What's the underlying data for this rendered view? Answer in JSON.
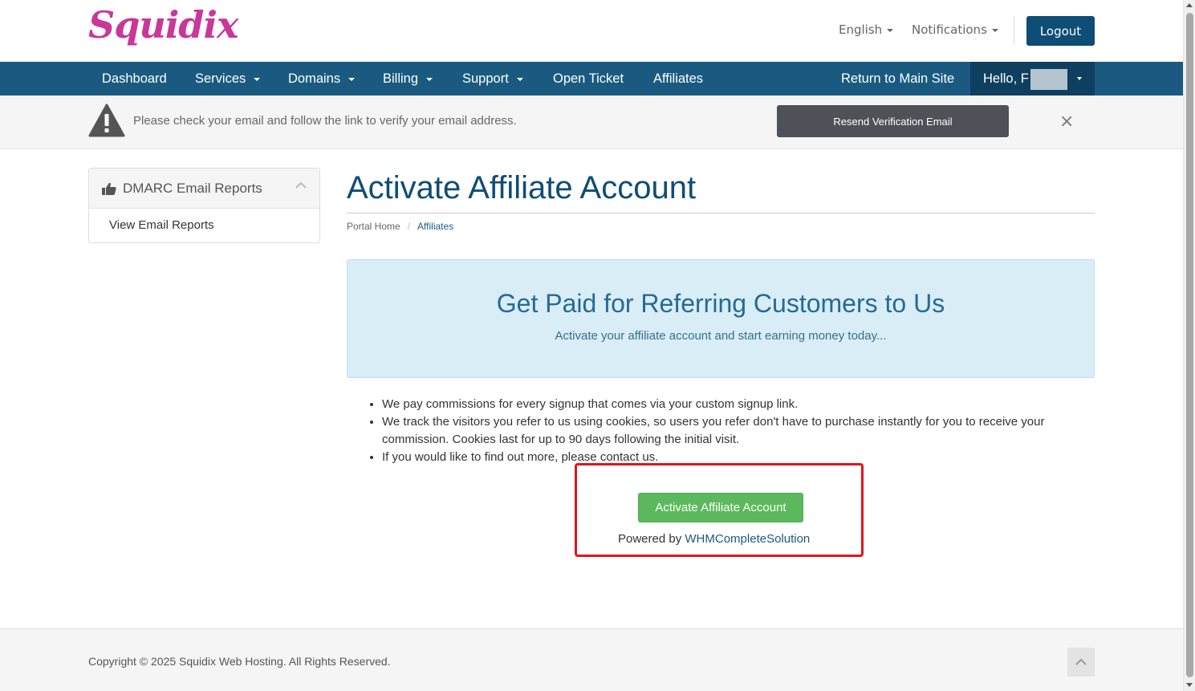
{
  "header": {
    "logo_text": "Squidix",
    "language_label": "English",
    "notifications_label": "Notifications",
    "logout_label": "Logout"
  },
  "nav": {
    "items": [
      {
        "label": "Dashboard",
        "dropdown": false
      },
      {
        "label": "Services",
        "dropdown": true
      },
      {
        "label": "Domains",
        "dropdown": true
      },
      {
        "label": "Billing",
        "dropdown": true
      },
      {
        "label": "Support",
        "dropdown": true
      },
      {
        "label": "Open Ticket",
        "dropdown": false
      },
      {
        "label": "Affiliates",
        "dropdown": false
      }
    ],
    "return_label": "Return to Main Site",
    "hello_label": "Hello, F"
  },
  "alert": {
    "message": "Please check your email and follow the link to verify your email address.",
    "resend_label": "Resend Verification Email",
    "close_symbol": "×"
  },
  "sidebar": {
    "panel_title": "DMARC Email Reports",
    "items": [
      {
        "label": "View Email Reports"
      }
    ]
  },
  "main": {
    "page_title": "Activate Affiliate Account",
    "breadcrumb": {
      "home": "Portal Home",
      "separator": "/",
      "current": "Affiliates"
    },
    "promo": {
      "title": "Get Paid for Referring Customers to Us",
      "subtitle": "Activate your affiliate account and start earning money today..."
    },
    "bullets": [
      "We pay commissions for every signup that comes via your custom signup link.",
      "We track the visitors you refer to us using cookies, so users you refer don't have to purchase instantly for you to receive your commission. Cookies last for up to 90 days following the initial visit.",
      "If you would like to find out more, please contact us."
    ],
    "activate_label": "Activate Affiliate Account",
    "powered_prefix": "Powered by ",
    "powered_link": "WHMCompleteSolution"
  },
  "footer": {
    "copyright": "Copyright © 2025 Squidix Web Hosting. All Rights Reserved."
  },
  "colors": {
    "brand_pink": "#c9379a",
    "nav_blue": "#1a5a80",
    "dark_blue": "#0e4d74",
    "success_green": "#5cb85c",
    "highlight_red": "#e0141e",
    "info_bg": "#d9edf7"
  },
  "icons": {
    "warning": "warning-triangle-icon",
    "thumbs_up": "thumbs-up-icon",
    "chevron_up": "chevron-up-icon",
    "close": "close-icon",
    "back_to_top": "chevron-up-icon"
  }
}
